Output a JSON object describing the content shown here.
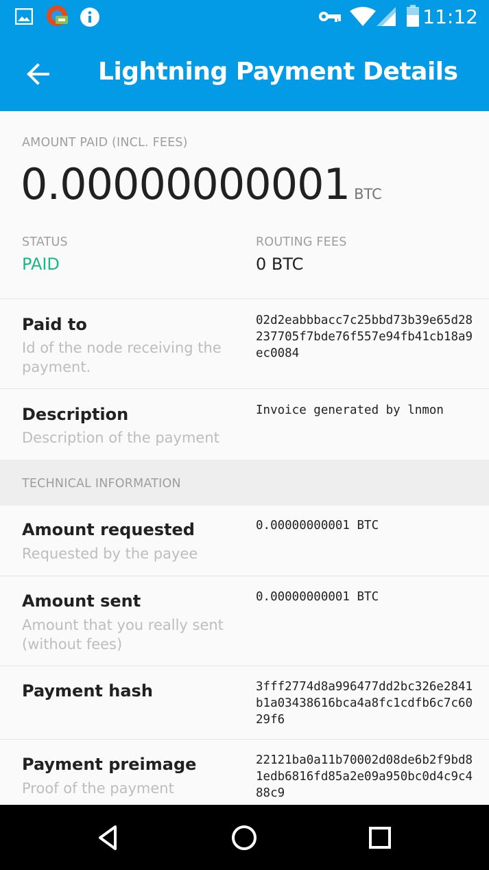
{
  "status_bar": {
    "time": "11:12",
    "left_icons": [
      "image-icon",
      "vpn-app-icon",
      "info-icon"
    ],
    "right_icons": [
      "key-icon",
      "wifi-icon",
      "signal-icon",
      "battery-icon"
    ]
  },
  "app_bar": {
    "title": "Lightning Payment Details",
    "color": "#039be5"
  },
  "summary": {
    "amount_caption": "AMOUNT PAID (INCL. FEES)",
    "amount_value": "0.00000000001",
    "amount_unit": "BTC",
    "status_caption": "STATUS",
    "status_value": "PAID",
    "status_color": "#1ab885",
    "fees_caption": "ROUTING FEES",
    "fees_value": "0 BTC"
  },
  "details": [
    {
      "title": "Paid to",
      "description": "Id of the node receiving the payment.",
      "value": "02d2eabbbacc7c25bbd73b39e65d28237705f7bde76f557e94fb41cb18a9ec0084"
    },
    {
      "title": "Description",
      "description": "Description of the payment",
      "value": "Invoice generated by lnmon"
    }
  ],
  "technical": {
    "header": "TECHNICAL INFORMATION",
    "rows": [
      {
        "title": "Amount requested",
        "description": "Requested by the payee",
        "value": "0.00000000001 BTC"
      },
      {
        "title": "Amount sent",
        "description": "Amount that you really sent (without fees)",
        "value": "0.00000000001 BTC"
      },
      {
        "title": "Payment hash",
        "description": "",
        "value": "3fff2774d8a996477dd2bc326e2841b1a03438616bca4a8fc1cdfb6c7c6029f6"
      },
      {
        "title": "Payment preimage",
        "description": "Proof of the payment",
        "value": "22121ba0a11b70002d08de6b2f9bd81edb6816fd85a2e09a950bc0d4c9c488c9"
      }
    ]
  },
  "nav_bar": {
    "buttons": [
      "back-nav-icon",
      "home-nav-icon",
      "recents-nav-icon"
    ]
  }
}
